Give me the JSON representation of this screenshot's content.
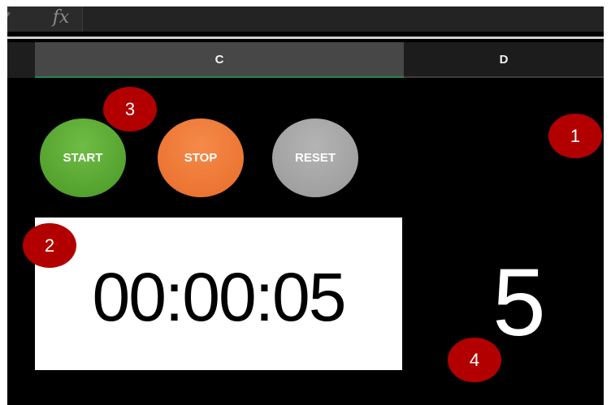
{
  "formula_bar": {
    "fx_label": "fx",
    "value": ""
  },
  "columns": [
    {
      "label": "C"
    },
    {
      "label": "D"
    }
  ],
  "stopwatch": {
    "buttons": {
      "start": {
        "label": "START",
        "color": "#55a32f"
      },
      "stop": {
        "label": "STOP",
        "color": "#ec7533"
      },
      "reset": {
        "label": "RESET",
        "color": "#a1a1a1"
      }
    },
    "timer_display": "00:00:05",
    "seconds_value": "5"
  },
  "callouts": [
    "1",
    "2",
    "3",
    "4"
  ],
  "colors": {
    "sheet_background": "#000000",
    "callout_red": "#b20000",
    "selected_column_header": "#474747",
    "selected_column_underline": "#1f8a4c"
  }
}
